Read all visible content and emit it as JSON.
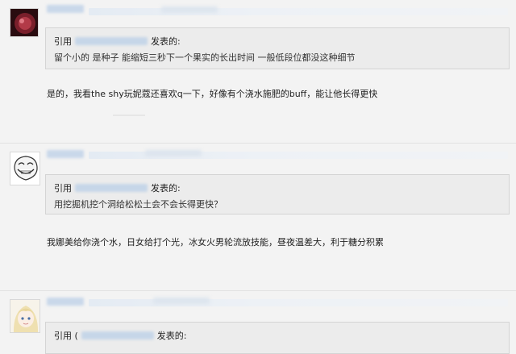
{
  "posts": [
    {
      "quote_prefix": "引用",
      "quote_suffix": "发表的:",
      "quote_text": "留个小的 是种子 能缩短三秒下一个果实的长出时间 一般低段位都没这种细节",
      "reply_text": "是的，我看the shy玩妮蔻还喜欢q一下，好像有个浇水施肥的buff，能让他长得更快"
    },
    {
      "quote_prefix": "引用",
      "quote_suffix": "发表的:",
      "quote_text": "用挖掘机挖个洞给松松土会不会长得更快？",
      "reply_text": "我娜美给你浇个水，日女给打个光，冰女火男轮流放技能，昼夜温差大，利于糖分积累"
    },
    {
      "quote_prefix": "引用 (",
      "quote_suffix": "发表的:"
    }
  ],
  "colors": {
    "background": "#f3f3f3",
    "quote_background": "#ececec",
    "username_blur": "#c9d8ea"
  }
}
